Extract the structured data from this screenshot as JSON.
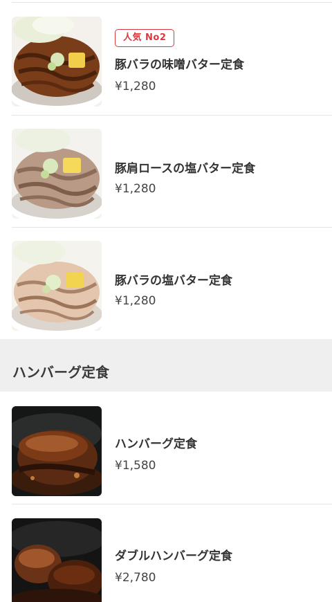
{
  "sections": [
    {
      "items": [
        {
          "badge": "人気 No2",
          "name": "豚バラの味噌バター定食",
          "price": "¥1,280",
          "image": "pork-belly-miso-butter"
        },
        {
          "name": "豚肩ロースの塩バター定食",
          "price": "¥1,280",
          "image": "pork-shoulder-salt-butter"
        },
        {
          "name": "豚バラの塩バター定食",
          "price": "¥1,280",
          "image": "pork-belly-salt-butter"
        }
      ]
    },
    {
      "title": "ハンバーグ定食",
      "items": [
        {
          "name": "ハンバーグ定食",
          "price": "¥1,580",
          "image": "hamburg-steak"
        },
        {
          "name": "ダブルハンバーグ定食",
          "price": "¥2,780",
          "image": "double-hamburg-steak"
        }
      ]
    }
  ],
  "colors": {
    "badge_accent": "#d9393e",
    "section_header_bg": "#efefef",
    "divider": "#e4e4e4"
  }
}
